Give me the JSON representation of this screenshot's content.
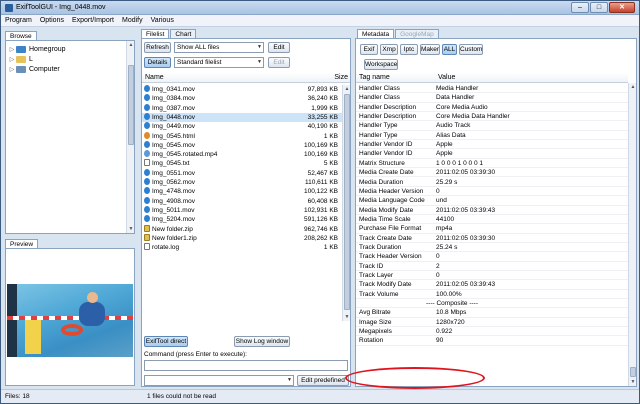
{
  "window": {
    "title": "ExifToolGUI - Img_0448.mov",
    "min_label": "–",
    "max_label": "□",
    "close_label": "✕"
  },
  "menu": [
    "Program",
    "Options",
    "Export/Import",
    "Modify",
    "Various"
  ],
  "browse": {
    "tab": "Browse",
    "items": [
      {
        "label": "Homegroup",
        "icon": "homegroup-icon"
      },
      {
        "label": "L",
        "icon": "user-folder-icon"
      },
      {
        "label": "Computer",
        "icon": "computer-icon"
      }
    ]
  },
  "preview": {
    "tab": "Preview"
  },
  "filelist": {
    "tabs": [
      "Filelist",
      "Chart"
    ],
    "refresh_label": "Refresh",
    "filter_value": "Show ALL files",
    "edit_label": "Edit",
    "details_label": "Details",
    "view_value": "Standard filelist",
    "col_name": "Name",
    "col_size": "Size",
    "files": [
      {
        "name": "Img_0341.mov",
        "size": "97,893 KB",
        "type": "mov"
      },
      {
        "name": "Img_0384.mov",
        "size": "36,240 KB",
        "type": "mov"
      },
      {
        "name": "Img_0387.mov",
        "size": "1,999 KB",
        "type": "mov"
      },
      {
        "name": "Img_0448.mov",
        "size": "33,255 KB",
        "type": "mov"
      },
      {
        "name": "Img_0449.mov",
        "size": "40,190 KB",
        "type": "mov"
      },
      {
        "name": "Img_0545.html",
        "size": "1 KB",
        "type": "html"
      },
      {
        "name": "Img_0545.mov",
        "size": "100,169 KB",
        "type": "mov"
      },
      {
        "name": "Img_0545.rotated.mp4",
        "size": "100,169 KB",
        "type": "mp4"
      },
      {
        "name": "Img_0545.txt",
        "size": "5 KB",
        "type": "txt"
      },
      {
        "name": "Img_0551.mov",
        "size": "52,467 KB",
        "type": "mov"
      },
      {
        "name": "Img_0562.mov",
        "size": "110,611 KB",
        "type": "mov"
      },
      {
        "name": "Img_4748.mov",
        "size": "100,122 KB",
        "type": "mov"
      },
      {
        "name": "Img_4908.mov",
        "size": "60,408 KB",
        "type": "mov"
      },
      {
        "name": "Img_5011.mov",
        "size": "102,931 KB",
        "type": "mov"
      },
      {
        "name": "Img_5204.mov",
        "size": "591,126 KB",
        "type": "mov"
      },
      {
        "name": "New folder.zip",
        "size": "962,746 KB",
        "type": "zip"
      },
      {
        "name": "New folder1.zip",
        "size": "208,262 KB",
        "type": "zip"
      },
      {
        "name": "rotate.log",
        "size": "1 KB",
        "type": "log"
      }
    ],
    "selected_index": 3,
    "exiftool_direct_label": "ExifTool direct",
    "show_log_label": "Show Log window",
    "command_label": "Command (press Enter to execute):",
    "edit_predefined_label": "Edit predefined"
  },
  "metadata": {
    "tabs": [
      "Metadata",
      "GoogleMap"
    ],
    "buttons": [
      "Exif",
      "Xmp",
      "Iptc",
      "Maker",
      "ALL",
      "Custom"
    ],
    "active_button": "ALL",
    "workspace_label": "Workspace",
    "col_tag": "Tag name",
    "col_value": "Value",
    "rows": [
      {
        "k": "Handler Class",
        "v": "Media Handler"
      },
      {
        "k": "Handler Class",
        "v": "Data Handler"
      },
      {
        "k": "Handler Description",
        "v": "Core Media Audio"
      },
      {
        "k": "Handler Description",
        "v": "Core Media Data Handler"
      },
      {
        "k": "Handler Type",
        "v": "Audio Track"
      },
      {
        "k": "Handler Type",
        "v": "Alias Data"
      },
      {
        "k": "Handler Vendor ID",
        "v": "Apple"
      },
      {
        "k": "Handler Vendor ID",
        "v": "Apple"
      },
      {
        "k": "Matrix Structure",
        "v": "1 0 0 0 1 0 0 0 1"
      },
      {
        "k": "Media Create Date",
        "v": "2011:02:05 03:39:30"
      },
      {
        "k": "Media Duration",
        "v": "25.29 s"
      },
      {
        "k": "Media Header Version",
        "v": "0"
      },
      {
        "k": "Media Language Code",
        "v": "und"
      },
      {
        "k": "Media Modify Date",
        "v": "2011:02:05 03:39:43"
      },
      {
        "k": "Media Time Scale",
        "v": "44100"
      },
      {
        "k": "Purchase File Format",
        "v": "mp4a"
      },
      {
        "k": "Track Create Date",
        "v": "2011:02:05 03:39:30"
      },
      {
        "k": "Track Duration",
        "v": "25.24 s"
      },
      {
        "k": "Track Header Version",
        "v": "0"
      },
      {
        "k": "Track ID",
        "v": "2"
      },
      {
        "k": "Track Layer",
        "v": "0"
      },
      {
        "k": "Track Modify Date",
        "v": "2011:02:05 03:39:43"
      },
      {
        "k": "Track Volume",
        "v": "100.00%"
      },
      {
        "k": "",
        "v": "---- Composite ----",
        "section": true
      },
      {
        "k": "Avg Bitrate",
        "v": "10.8 Mbps"
      },
      {
        "k": "Image Size",
        "v": "1280x720"
      },
      {
        "k": "Megapixels",
        "v": "0.922"
      },
      {
        "k": "Rotation",
        "v": "90"
      }
    ]
  },
  "status": {
    "files": "Files: 18",
    "message": "1 files could not be read"
  },
  "colors": {
    "selection": "#cde3f8",
    "highlight_ring": "#e0141e"
  }
}
